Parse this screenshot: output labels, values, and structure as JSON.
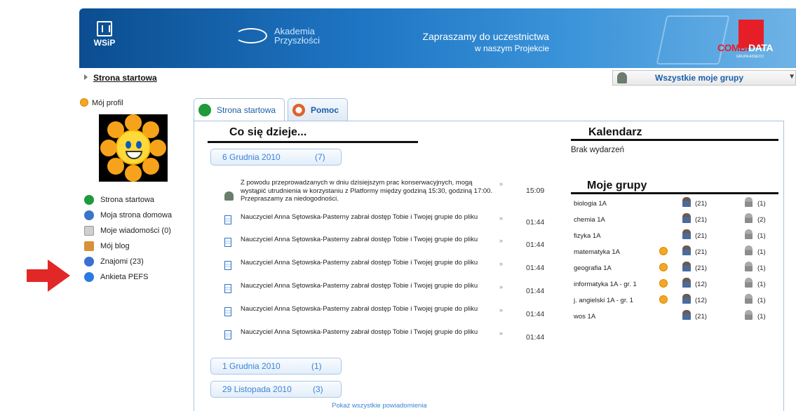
{
  "banner": {
    "wsip_logo": "WSiP",
    "akademia_line1": "Akademia",
    "akademia_line2": "Przyszłości",
    "invite_line1": "Zapraszamy do uczestnictwa",
    "invite_line2": "w naszym Projekcie",
    "partner_logo_a": "COMBI",
    "partner_logo_b": "DATA",
    "partner_sub": "GRUPA ASSECO"
  },
  "breadcrumb": {
    "label": "Strona startowa"
  },
  "group_selector": {
    "value": "Wszystkie moje grupy",
    "arrow": "▼",
    "icon": "group-icon"
  },
  "profile": {
    "label": "Mój profil"
  },
  "left_nav": [
    {
      "label": "Strona startowa",
      "icon": "arrow-right-icon",
      "color": "#1e9a3a"
    },
    {
      "label": "Moja strona domowa",
      "icon": "home-icon",
      "color": "#3b74c7"
    },
    {
      "label": "Moje wiadomości (0)",
      "icon": "envelope-icon",
      "color": "#cfcfcf"
    },
    {
      "label": "Mój blog",
      "icon": "blog-icon",
      "color": "#d9903a"
    },
    {
      "label": "Znajomi (23)",
      "icon": "friends-icon",
      "color": "#3b6fd1"
    },
    {
      "label": "Ankieta PEFS",
      "icon": "arrow-blue-icon",
      "color": "#2b7ae0"
    }
  ],
  "tabs": [
    {
      "label": "Strona startowa",
      "icon": "arrow-circle-icon",
      "color": "#1e9a3a"
    },
    {
      "label": "Pomoc",
      "icon": "lifebuoy-icon",
      "color": "#e0612b"
    }
  ],
  "news": {
    "title": "Co się dzieje...",
    "groups": [
      {
        "date": "6  Grudnia 2010",
        "count": "(7)"
      },
      {
        "date": "1  Grudnia 2010",
        "count": "(1)"
      },
      {
        "date": "29  Listopada 2010",
        "count": "(3)"
      }
    ],
    "items": [
      {
        "text": "Z powodu przeprowadzanych w dniu dzisiejszym prac konserwacyjnych, mogą wystąpić utrudnienia w korzystaniu z Platformy między godziną 15:30, godziną 17:00. Przepraszamy za niedogodności.",
        "time": "15:09",
        "icon": "system-icon",
        "more": "»"
      },
      {
        "text": "Nauczyciel Anna Sętowska-Pasterny zabrał dostęp Tobie i Twojej grupie do pliku",
        "time": "01:44",
        "icon": "document-icon",
        "more": "»"
      },
      {
        "text": "Nauczyciel Anna Sętowska-Pasterny zabrał dostęp Tobie i Twojej grupie do pliku",
        "time": "01:44",
        "icon": "document-icon",
        "more": "»"
      },
      {
        "text": "Nauczyciel Anna Sętowska-Pasterny zabrał dostęp Tobie i Twojej grupie do pliku",
        "time": "01:44",
        "icon": "document-icon",
        "more": "»"
      },
      {
        "text": "Nauczyciel Anna Sętowska-Pasterny zabrał dostęp Tobie i Twojej grupie do pliku",
        "time": "01:44",
        "icon": "document-icon",
        "more": "»"
      },
      {
        "text": "Nauczyciel Anna Sętowska-Pasterny zabrał dostęp Tobie i Twojej grupie do pliku",
        "time": "01:44",
        "icon": "document-icon",
        "more": "»"
      },
      {
        "text": "Nauczyciel Anna Sętowska-Pasterny zabrał dostęp Tobie i Twojej grupie do pliku",
        "time": "01:44",
        "icon": "document-icon",
        "more": "»"
      }
    ],
    "show_all": "Pokaż wszystkie powiadomienia"
  },
  "calendar": {
    "title": "Kalendarz",
    "empty": "Brak wydarzeń"
  },
  "my_groups": {
    "title": "Moje grupy",
    "rows": [
      {
        "name": "biologia 1A",
        "warning": false,
        "teachers": "(21)",
        "students": "(1)"
      },
      {
        "name": "chemia 1A",
        "warning": false,
        "teachers": "(21)",
        "students": "(2)"
      },
      {
        "name": "fizyka 1A",
        "warning": false,
        "teachers": "(21)",
        "students": "(1)"
      },
      {
        "name": "matematyka 1A",
        "warning": true,
        "teachers": "(21)",
        "students": "(1)"
      },
      {
        "name": "geografia 1A",
        "warning": true,
        "teachers": "(21)",
        "students": "(1)"
      },
      {
        "name": "informatyka 1A - gr. 1",
        "warning": true,
        "teachers": "(12)",
        "students": "(1)"
      },
      {
        "name": "j. angielski 1A - gr. 1",
        "warning": true,
        "teachers": "(12)",
        "students": "(1)"
      },
      {
        "name": "wos 1A",
        "warning": false,
        "teachers": "(21)",
        "students": "(1)"
      }
    ]
  },
  "colors": {
    "accent": "#1a5fa8",
    "link": "#3a84d4",
    "annotation_arrow": "#e22727"
  }
}
